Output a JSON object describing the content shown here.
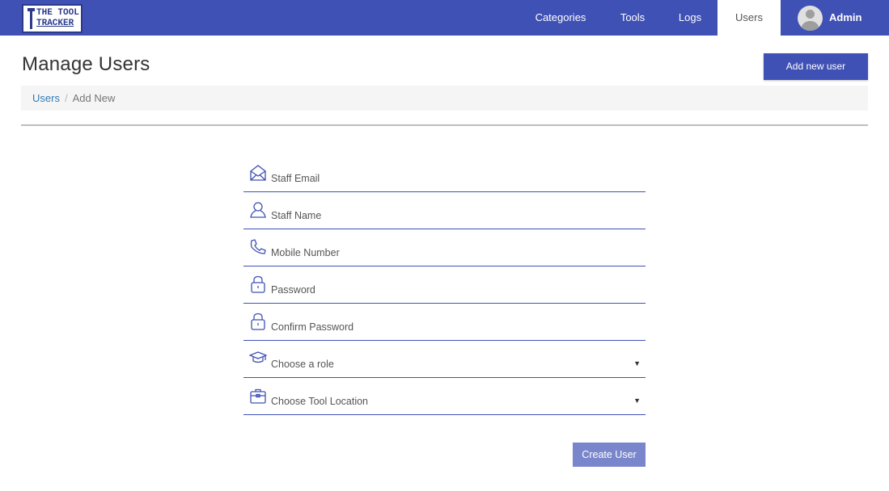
{
  "app": {
    "logo_line1": "THE TOOL",
    "logo_line2": "TRACKER"
  },
  "nav": {
    "categories": "Categories",
    "tools": "Tools",
    "logs": "Logs",
    "users": "Users",
    "admin": "Admin",
    "active": "Users"
  },
  "header": {
    "title": "Manage Users",
    "add_button": "Add new user"
  },
  "breadcrumb": {
    "link": "Users",
    "separator": "/",
    "current": "Add New"
  },
  "form": {
    "fields": [
      {
        "icon": "envelope-icon",
        "placeholder": "Staff Email"
      },
      {
        "icon": "user-icon",
        "placeholder": "Staff Name"
      },
      {
        "icon": "phone-icon",
        "placeholder": "Mobile Number"
      },
      {
        "icon": "lock-icon",
        "placeholder": "Password"
      },
      {
        "icon": "lock-icon",
        "placeholder": "Confirm Password"
      },
      {
        "icon": "graduation-cap-icon",
        "placeholder": "Choose a role",
        "dropdown": true
      },
      {
        "icon": "briefcase-icon",
        "placeholder": "Choose Tool Location",
        "dropdown": true
      }
    ],
    "caret": "▼",
    "submit": "Create User"
  },
  "colors": {
    "primary": "#3f51b5",
    "button_disabled": "#7986cb",
    "breadcrumb_bg": "#f5f5f5",
    "link": "#337ab7"
  }
}
